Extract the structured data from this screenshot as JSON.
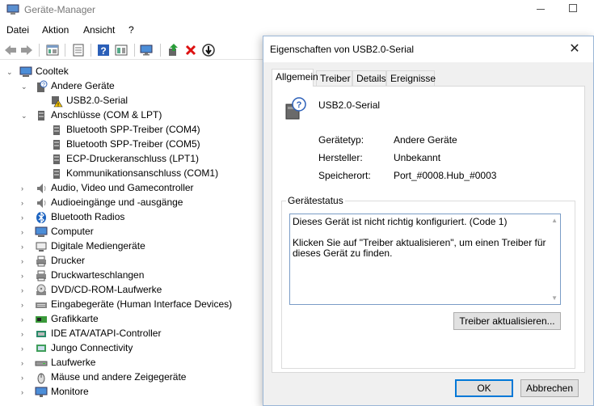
{
  "window": {
    "title": "Geräte-Manager"
  },
  "menu": [
    "Datei",
    "Aktion",
    "Ansicht",
    "?"
  ],
  "toolbar": [
    "back-icon",
    "forward-icon",
    "show-hidden-icon",
    "properties-icon",
    "help-icon",
    "action-pane-icon",
    "monitor-icon",
    "update-driver-icon",
    "uninstall-icon",
    "disable-icon"
  ],
  "tree": {
    "root": "Cooltek",
    "items": [
      {
        "label": "Andere Geräte",
        "icon": "other-devices-icon",
        "expanded": true
      },
      {
        "label": "USB2.0-Serial",
        "icon": "warning-device-icon",
        "child": true
      },
      {
        "label": "Anschlüsse (COM & LPT)",
        "icon": "port-icon",
        "expanded": true
      },
      {
        "label": "Bluetooth SPP-Treiber (COM4)",
        "icon": "port-icon",
        "child": true
      },
      {
        "label": "Bluetooth SPP-Treiber (COM5)",
        "icon": "port-icon",
        "child": true
      },
      {
        "label": "ECP-Druckeranschluss (LPT1)",
        "icon": "port-icon",
        "child": true
      },
      {
        "label": "Kommunikationsanschluss (COM1)",
        "icon": "port-icon",
        "child": true
      },
      {
        "label": "Audio, Video und Gamecontroller",
        "icon": "speaker-icon"
      },
      {
        "label": "Audioeingänge und -ausgänge",
        "icon": "speaker-icon"
      },
      {
        "label": "Bluetooth Radios",
        "icon": "bluetooth-icon"
      },
      {
        "label": "Computer",
        "icon": "computer-icon"
      },
      {
        "label": "Digitale Mediengeräte",
        "icon": "media-device-icon"
      },
      {
        "label": "Drucker",
        "icon": "printer-icon"
      },
      {
        "label": "Druckwarteschlangen",
        "icon": "printer-icon"
      },
      {
        "label": "DVD/CD-ROM-Laufwerke",
        "icon": "dvd-icon"
      },
      {
        "label": "Eingabegeräte (Human Interface Devices)",
        "icon": "hid-icon"
      },
      {
        "label": "Grafikkarte",
        "icon": "display-adapter-icon"
      },
      {
        "label": "IDE ATA/ATAPI-Controller",
        "icon": "ide-controller-icon"
      },
      {
        "label": "Jungo Connectivity",
        "icon": "network-icon"
      },
      {
        "label": "Laufwerke",
        "icon": "disk-drive-icon"
      },
      {
        "label": "Mäuse und andere Zeigegeräte",
        "icon": "mouse-icon"
      },
      {
        "label": "Monitore",
        "icon": "monitor-icon"
      }
    ]
  },
  "dialog": {
    "title": "Eigenschaften von USB2.0-Serial",
    "tabs": [
      "Allgemein",
      "Treiber",
      "Details",
      "Ereignisse"
    ],
    "device_name": "USB2.0-Serial",
    "properties": [
      {
        "label": "Gerätetyp:",
        "value": "Andere Geräte"
      },
      {
        "label": "Hersteller:",
        "value": "Unbekannt"
      },
      {
        "label": "Speicherort:",
        "value": "Port_#0008.Hub_#0003"
      }
    ],
    "status_group": "Gerätestatus",
    "status_text": "Dieses Gerät ist nicht richtig konfiguriert. (Code 1)\n\nKlicken Sie auf \"Treiber aktualisieren\", um einen Treiber für dieses Gerät zu finden.",
    "update_button": "Treiber aktualisieren...",
    "ok_button": "OK",
    "cancel_button": "Abbrechen"
  }
}
